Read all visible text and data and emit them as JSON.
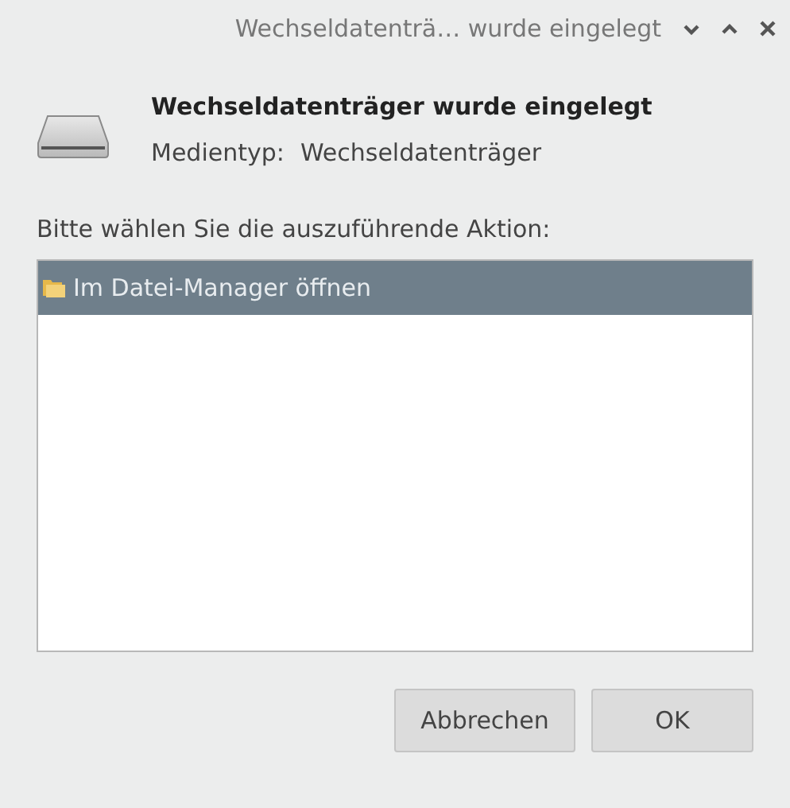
{
  "window": {
    "title": "Wechseldatenträ… wurde eingelegt"
  },
  "header": {
    "title": "Wechseldatenträger wurde eingelegt",
    "media_label": "Medientyp:",
    "media_value": "Wechseldatenträger"
  },
  "prompt": "Bitte wählen Sie die auszuführende Aktion:",
  "actions": [
    {
      "label": "Im Datei-Manager öffnen",
      "selected": true
    }
  ],
  "buttons": [
    "Abbrechen",
    "OK"
  ]
}
